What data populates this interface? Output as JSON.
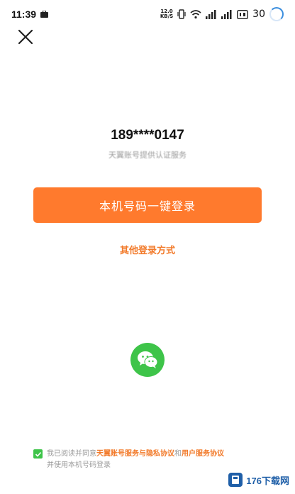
{
  "status_bar": {
    "time": "11:39",
    "net_speed_top": "12.0",
    "net_speed_bottom": "KB/S",
    "battery": "30"
  },
  "login": {
    "masked_phone": "189****0147",
    "auth_note": "天翼账号提供认证服务",
    "one_tap_label": "本机号码一键登录",
    "other_methods_label": "其他登录方式"
  },
  "agreement": {
    "checked": true,
    "prefix": "我已阅读并同意",
    "link_account": "天翼账号服务与隐私协议",
    "middle": "和",
    "link_user": "用户服务协议",
    "line2": "并使用本机号码登录"
  },
  "watermark": {
    "text": "176下载网"
  },
  "colors": {
    "accent": "#ff7a2d",
    "link": "#f27a2a",
    "wechat": "#3ec449"
  },
  "icons": [
    "close-icon",
    "wechat-icon",
    "wifi-icon",
    "signal-icon",
    "battery-icon",
    "check-icon"
  ]
}
